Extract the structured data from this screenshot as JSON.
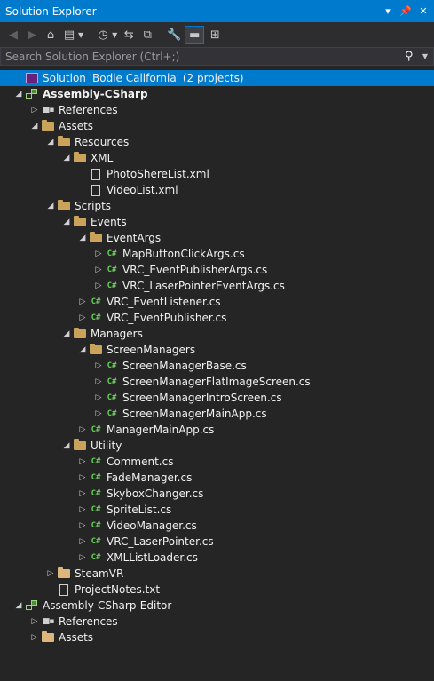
{
  "window": {
    "title": "Solution Explorer"
  },
  "search": {
    "placeholder": "Search Solution Explorer (Ctrl+;)"
  },
  "tree": [
    {
      "label": "Solution 'Bodie California' (2 projects)",
      "depth": 0,
      "icon": "solution-icon",
      "exp": "",
      "selected": true,
      "bold": false
    },
    {
      "label": "Assembly-CSharp",
      "depth": 0,
      "icon": "project-icon",
      "exp": "open",
      "bold": true
    },
    {
      "label": "References",
      "depth": 1,
      "icon": "references-icon",
      "exp": "closed"
    },
    {
      "label": "Assets",
      "depth": 1,
      "icon": "folder-open-icon",
      "exp": "open"
    },
    {
      "label": "Resources",
      "depth": 2,
      "icon": "folder-open-icon",
      "exp": "open"
    },
    {
      "label": "XML",
      "depth": 3,
      "icon": "folder-open-icon",
      "exp": "open"
    },
    {
      "label": "PhotoShereList.xml",
      "depth": 4,
      "icon": "xml-file-icon",
      "exp": ""
    },
    {
      "label": "VideoList.xml",
      "depth": 4,
      "icon": "xml-file-icon",
      "exp": ""
    },
    {
      "label": "Scripts",
      "depth": 2,
      "icon": "folder-open-icon",
      "exp": "open"
    },
    {
      "label": "Events",
      "depth": 3,
      "icon": "folder-open-icon",
      "exp": "open"
    },
    {
      "label": "EventArgs",
      "depth": 4,
      "icon": "folder-open-icon",
      "exp": "open"
    },
    {
      "label": "MapButtonClickArgs.cs",
      "depth": 5,
      "icon": "csharp-file-icon",
      "exp": "closed"
    },
    {
      "label": "VRC_EventPublisherArgs.cs",
      "depth": 5,
      "icon": "csharp-file-icon",
      "exp": "closed"
    },
    {
      "label": "VRC_LaserPointerEventArgs.cs",
      "depth": 5,
      "icon": "csharp-file-icon",
      "exp": "closed"
    },
    {
      "label": "VRC_EventListener.cs",
      "depth": 4,
      "icon": "csharp-file-icon",
      "exp": "closed"
    },
    {
      "label": "VRC_EventPublisher.cs",
      "depth": 4,
      "icon": "csharp-file-icon",
      "exp": "closed"
    },
    {
      "label": "Managers",
      "depth": 3,
      "icon": "folder-open-icon",
      "exp": "open"
    },
    {
      "label": "ScreenManagers",
      "depth": 4,
      "icon": "folder-open-icon",
      "exp": "open"
    },
    {
      "label": "ScreenManagerBase.cs",
      "depth": 5,
      "icon": "csharp-file-icon",
      "exp": "closed"
    },
    {
      "label": "ScreenManagerFlatImageScreen.cs",
      "depth": 5,
      "icon": "csharp-file-icon",
      "exp": "closed"
    },
    {
      "label": "ScreenManagerIntroScreen.cs",
      "depth": 5,
      "icon": "csharp-file-icon",
      "exp": "closed"
    },
    {
      "label": "ScreenManagerMainApp.cs",
      "depth": 5,
      "icon": "csharp-file-icon",
      "exp": "closed"
    },
    {
      "label": "ManagerMainApp.cs",
      "depth": 4,
      "icon": "csharp-file-icon",
      "exp": "closed"
    },
    {
      "label": "Utility",
      "depth": 3,
      "icon": "folder-open-icon",
      "exp": "open"
    },
    {
      "label": "Comment.cs",
      "depth": 4,
      "icon": "csharp-file-icon",
      "exp": "closed"
    },
    {
      "label": "FadeManager.cs",
      "depth": 4,
      "icon": "csharp-file-icon",
      "exp": "closed"
    },
    {
      "label": "SkyboxChanger.cs",
      "depth": 4,
      "icon": "csharp-file-icon",
      "exp": "closed"
    },
    {
      "label": "SpriteList.cs",
      "depth": 4,
      "icon": "csharp-file-icon",
      "exp": "closed"
    },
    {
      "label": "VideoManager.cs",
      "depth": 4,
      "icon": "csharp-file-icon",
      "exp": "closed"
    },
    {
      "label": "VRC_LaserPointer.cs",
      "depth": 4,
      "icon": "csharp-file-icon",
      "exp": "closed"
    },
    {
      "label": "XMLListLoader.cs",
      "depth": 4,
      "icon": "csharp-file-icon",
      "exp": "closed"
    },
    {
      "label": "SteamVR",
      "depth": 2,
      "icon": "folder-icon",
      "exp": "closed"
    },
    {
      "label": "ProjectNotes.txt",
      "depth": 2,
      "icon": "text-file-icon",
      "exp": ""
    },
    {
      "label": "Assembly-CSharp-Editor",
      "depth": 0,
      "icon": "project-icon",
      "exp": "open",
      "bold": false
    },
    {
      "label": "References",
      "depth": 1,
      "icon": "references-icon",
      "exp": "closed"
    },
    {
      "label": "Assets",
      "depth": 1,
      "icon": "folder-icon",
      "exp": "closed"
    }
  ]
}
